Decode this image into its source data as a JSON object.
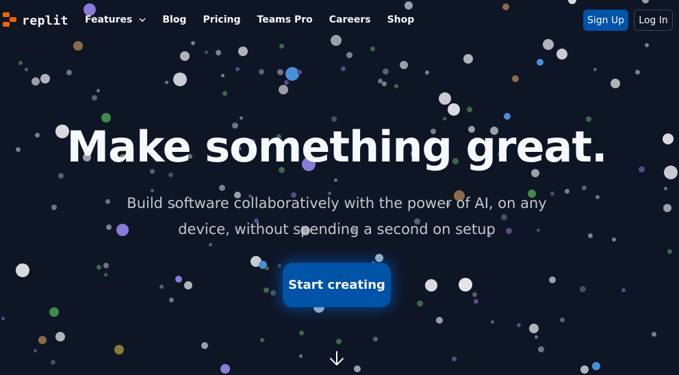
{
  "brand": {
    "name": "replit",
    "accent": "#f26207"
  },
  "nav": {
    "items": [
      {
        "label": "Features",
        "has_dropdown": true
      },
      {
        "label": "Blog"
      },
      {
        "label": "Pricing"
      },
      {
        "label": "Teams Pro"
      },
      {
        "label": "Careers"
      },
      {
        "label": "Shop"
      }
    ],
    "signup_label": "Sign Up",
    "login_label": "Log In"
  },
  "hero": {
    "title": "Make something great.",
    "subtitle": "Build software collaboratively with the power of AI, on any device, without spending a second on setup",
    "cta_label": "Start creating"
  },
  "colors": {
    "background": "#0e1525",
    "primary_button": "#0053a6",
    "text": "#f5f9fc",
    "subtext": "#c2c8cc"
  },
  "icons": [
    "chevron-down-icon",
    "arrow-down-icon"
  ]
}
